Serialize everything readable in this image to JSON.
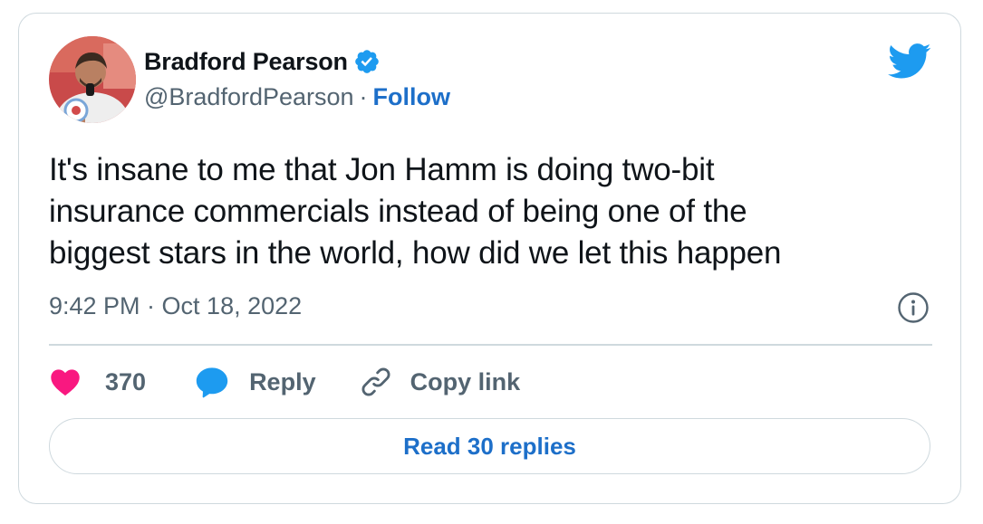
{
  "author": {
    "name": "Bradford Pearson",
    "handle": "@BradfordPearson",
    "separator": "·",
    "follow_label": "Follow",
    "verified": true
  },
  "tweet": {
    "text": "It's insane to me that Jon Hamm is doing two-bit\ninsurance commercials instead of being one of the\nbiggest stars in the world, how did we let this happen",
    "timestamp": "9:42 PM · Oct 18, 2022"
  },
  "actions": {
    "like_count": "370",
    "reply_label": "Reply",
    "copy_link_label": "Copy link"
  },
  "read_replies_label": "Read 30 replies",
  "icons": {
    "brand": "twitter-bird-icon",
    "verified": "verified-badge-icon",
    "info": "info-icon",
    "like": "heart-icon",
    "reply": "speech-bubble-icon",
    "copy": "link-icon"
  },
  "colors": {
    "twitter_blue": "#1d9bf0",
    "link_blue": "#1d6fc9",
    "like_pink": "#f91880",
    "text_primary": "#0f1419",
    "text_secondary": "#536471",
    "border": "#cfd9de"
  }
}
